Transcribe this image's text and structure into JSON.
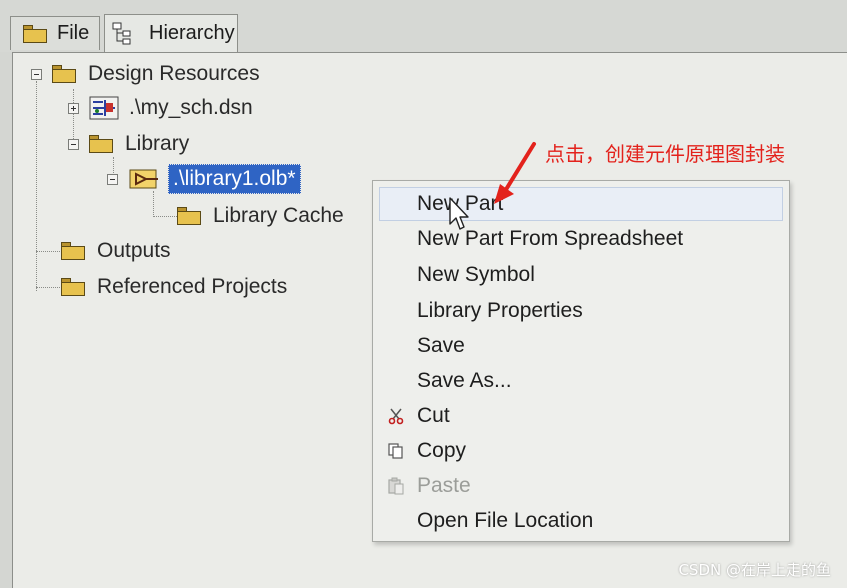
{
  "tabs": [
    {
      "label": "File",
      "icon": "folder-icon"
    },
    {
      "label": "Hierarchy",
      "icon": "hierarchy-icon"
    }
  ],
  "tree": {
    "design_resources": "Design Resources",
    "schematic": ".\\my_sch.dsn",
    "library": "Library",
    "library_file": ".\\library1.olb*",
    "library_cache": "Library Cache",
    "outputs": "Outputs",
    "referenced_projects": "Referenced Projects"
  },
  "context_menu": {
    "items": [
      {
        "label": "New Part",
        "state": "hover"
      },
      {
        "label": "New Part From Spreadsheet",
        "state": "normal"
      },
      {
        "label": "New Symbol",
        "state": "normal"
      },
      {
        "label": "Library Properties",
        "state": "normal"
      },
      {
        "label": "Save",
        "state": "normal"
      },
      {
        "label": "Save As...",
        "state": "normal"
      },
      {
        "label": "Cut",
        "state": "normal",
        "icon": "scissors-icon"
      },
      {
        "label": "Copy",
        "state": "normal",
        "icon": "copy-icon"
      },
      {
        "label": "Paste",
        "state": "disabled",
        "icon": "paste-icon"
      },
      {
        "label": "Open File Location",
        "state": "normal"
      }
    ]
  },
  "annotation": {
    "text": "点击，创建元件原理图封装",
    "color": "#e3221c"
  },
  "watermark": "CSDN @在岸上走的鱼",
  "colors": {
    "selection": "#2f64c4",
    "folder": "#e7c24e"
  }
}
